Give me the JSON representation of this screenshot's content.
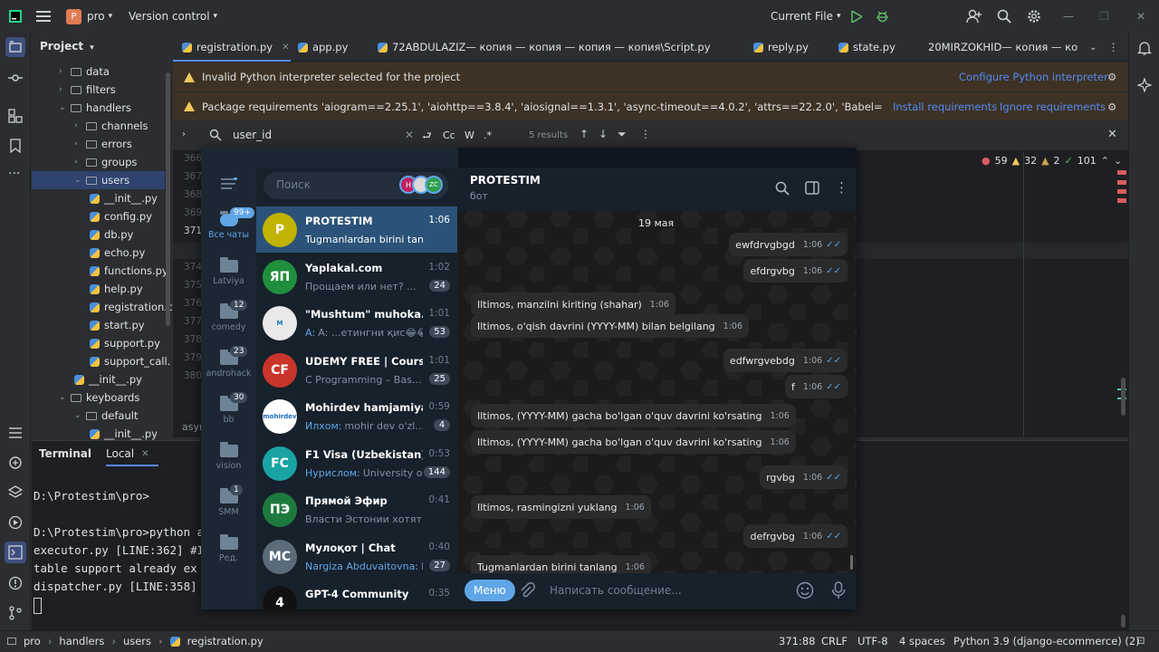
{
  "ide": {
    "project_name": "pro",
    "project_initial": "P",
    "vcs": "Version control",
    "run_config": "Current File",
    "project_panel_title": "Project",
    "tree": [
      {
        "label": "data",
        "type": "folder",
        "level": 1,
        "expanded": false
      },
      {
        "label": "filters",
        "type": "folder",
        "level": 1,
        "expanded": false
      },
      {
        "label": "handlers",
        "type": "folder",
        "level": 1,
        "expanded": true
      },
      {
        "label": "channels",
        "type": "folder",
        "level": 2,
        "expanded": false
      },
      {
        "label": "errors",
        "type": "folder",
        "level": 2,
        "expanded": false
      },
      {
        "label": "groups",
        "type": "folder",
        "level": 2,
        "expanded": false
      },
      {
        "label": "users",
        "type": "folder",
        "level": 2,
        "expanded": true,
        "selected": true
      },
      {
        "label": "__init__.py",
        "type": "py",
        "level": 3
      },
      {
        "label": "config.py",
        "type": "py",
        "level": 3
      },
      {
        "label": "db.py",
        "type": "py",
        "level": 3
      },
      {
        "label": "echo.py",
        "type": "py",
        "level": 3
      },
      {
        "label": "functions.py",
        "type": "py",
        "level": 3
      },
      {
        "label": "help.py",
        "type": "py",
        "level": 3
      },
      {
        "label": "registration.py",
        "type": "py",
        "level": 3
      },
      {
        "label": "start.py",
        "type": "py",
        "level": 3
      },
      {
        "label": "support.py",
        "type": "py",
        "level": 3
      },
      {
        "label": "support_call.",
        "type": "py",
        "level": 3
      },
      {
        "label": "__init__.py",
        "type": "py",
        "level": 2
      },
      {
        "label": "keyboards",
        "type": "folder",
        "level": 1,
        "expanded": true
      },
      {
        "label": "default",
        "type": "folder",
        "level": 2,
        "expanded": true
      },
      {
        "label": "__init__.py",
        "type": "py",
        "level": 3
      }
    ],
    "tabs": [
      "registration.py",
      "app.py",
      "72ABDULAZIZ— копия — копия — копия — копия\\Script.py",
      "reply.py",
      "state.py",
      "20MIRZOKHID— копия — коп"
    ],
    "banner1": {
      "text": "Invalid Python interpreter selected for the project",
      "action": "Configure Python interpreter"
    },
    "banner2": {
      "text": "Package requirements 'aiogram==2.25.1', 'aiohttp==3.8.4', 'aiosignal==1.3.1', 'async-timeout==4.0.2', 'attrs==22.2.0', 'Babel==2.9.1', 'certifi==2...",
      "action1": "Install requirements",
      "action2": "Ignore requirements"
    },
    "search": {
      "query": "user_id",
      "case": "Cc",
      "word": "W",
      "regex": ".*",
      "results": "5 results"
    },
    "line_numbers": [
      "366",
      "367",
      "368",
      "369",
      "371",
      "373",
      "374",
      "375",
      "376",
      "377",
      "378",
      "379",
      "380"
    ],
    "editor_trailing": "asyn",
    "inspections": {
      "errors": "59",
      "warnings": "32",
      "weak": "2",
      "ok": "101"
    },
    "terminal": {
      "title": "Terminal",
      "tab": "Local",
      "lines": [
        "D:\\Protestim\\pro>",
        "",
        "D:\\Protestim\\pro>python a",
        "executor.py [LINE:362] #I",
        " table support already ex",
        "dispatcher.py [LINE:358]"
      ]
    },
    "breadcrumbs": [
      "pro",
      "handlers",
      "users",
      "registration.py"
    ],
    "status": {
      "position": "371:88",
      "line_sep": "CRLF",
      "encoding": "UTF-8",
      "indent": "4 spaces",
      "interpreter": "Python 3.9 (django-ecommerce) (2)"
    }
  },
  "telegram": {
    "search_placeholder": "Поиск",
    "story_initials": [
      "H",
      "",
      "ZC"
    ],
    "folders": [
      {
        "label": "Все чаты",
        "badge": "99+",
        "active": true
      },
      {
        "label": "Latviya",
        "badge": ""
      },
      {
        "label": "comedy",
        "badge": "12"
      },
      {
        "label": "androhack",
        "badge": "23"
      },
      {
        "label": "bb",
        "badge": "30"
      },
      {
        "label": "vision",
        "badge": ""
      },
      {
        "label": "SMM",
        "badge": "1"
      },
      {
        "label": "Ред.",
        "badge": ""
      }
    ],
    "chats": [
      {
        "name": "PROTESTIM",
        "preview": "Tugmanlardan birini tanlang",
        "time": "1:06",
        "badge": "",
        "avatar": "P",
        "color": "#c2b300",
        "active": true
      },
      {
        "name": "Yaplakal.com",
        "preview": "Прощаем или нет? ...",
        "time": "1:02",
        "badge": "24",
        "avatar": "ЯП",
        "color": "#1f8f3d"
      },
      {
        "name": "\"Mushtum\" muhoka...",
        "preview": "А: ...етингни қис😂😂😂",
        "time": "1:01",
        "badge": "53",
        "avatar": "M",
        "color": "#e9e9e9",
        "sender": "А:"
      },
      {
        "name": "UDEMY FREE | Cours...",
        "preview": "C Programming – Bas...",
        "time": "1:01",
        "badge": "25",
        "avatar": "CF",
        "color": "#c9342b"
      },
      {
        "name": "Mohirdev hamjamiyati",
        "preview": "mohir dev o'zl...",
        "time": "0:59",
        "badge": "4",
        "avatar": "mohirdev",
        "color": "#ffffff",
        "sender": "Илхом:"
      },
      {
        "name": "F1 Visa (Uzbekistan) ...",
        "preview": "University o...",
        "time": "0:53",
        "badge": "144",
        "avatar": "FC",
        "color": "#1aa3a3",
        "sender": "Нурислом:"
      },
      {
        "name": "Прямой Эфир",
        "preview": "Власти Эстонии хотят рас...",
        "time": "0:41",
        "badge": "",
        "avatar": "ПЭ",
        "color": "#1d7a3f"
      },
      {
        "name": "Мулоқот | Chat",
        "preview": "B...",
        "time": "0:40",
        "badge": "27",
        "avatar": "MC",
        "color": "#5a6b7a",
        "sender": "Nargiza Abduvaitovna:"
      },
      {
        "name": "GPT-4 Community",
        "preview": "...",
        "time": "0:35",
        "badge": "",
        "avatar": "4",
        "color": "#111111"
      }
    ],
    "header": {
      "name": "PROTESTIM",
      "status": "бот"
    },
    "date": "19 мая",
    "messages": [
      {
        "text": "ewfdrvgbgd",
        "time": "1:06",
        "dir": "out"
      },
      {
        "text": "efdrgvbg",
        "time": "1:06",
        "dir": "out"
      },
      {
        "text": "Iltimos, manzilni kiriting (shahar)",
        "time": "1:06",
        "dir": "in"
      },
      {
        "text": "Iltimos, o'qish davrini (YYYY-MM) bilan belgilang",
        "time": "1:06",
        "dir": "in"
      },
      {
        "text": "edfwrgvebdg",
        "time": "1:06",
        "dir": "out"
      },
      {
        "text": "f",
        "time": "1:06",
        "dir": "out"
      },
      {
        "text": "Iltimos, (YYYY-MM) gacha bo'lgan o'quv davrini ko'rsating",
        "time": "1:06",
        "dir": "in"
      },
      {
        "text": "Iltimos, (YYYY-MM) gacha bo'lgan o'quv davrini ko'rsating",
        "time": "1:06",
        "dir": "in"
      },
      {
        "text": "rgvbg",
        "time": "1:06",
        "dir": "out"
      },
      {
        "text": "Iltimos, rasmingizni yuklang",
        "time": "1:06",
        "dir": "in"
      },
      {
        "text": "defrgvbg",
        "time": "1:06",
        "dir": "out"
      },
      {
        "text": "Tugmanlardan birini tanlang",
        "time": "1:06",
        "dir": "in"
      }
    ],
    "menu_button": "Меню",
    "input_placeholder": "Написать сообщение..."
  },
  "colors": {
    "accent": "#548af7",
    "warning": "#f2c55c",
    "tg_blue": "#5fa6e6",
    "error": "#db5c5c"
  }
}
